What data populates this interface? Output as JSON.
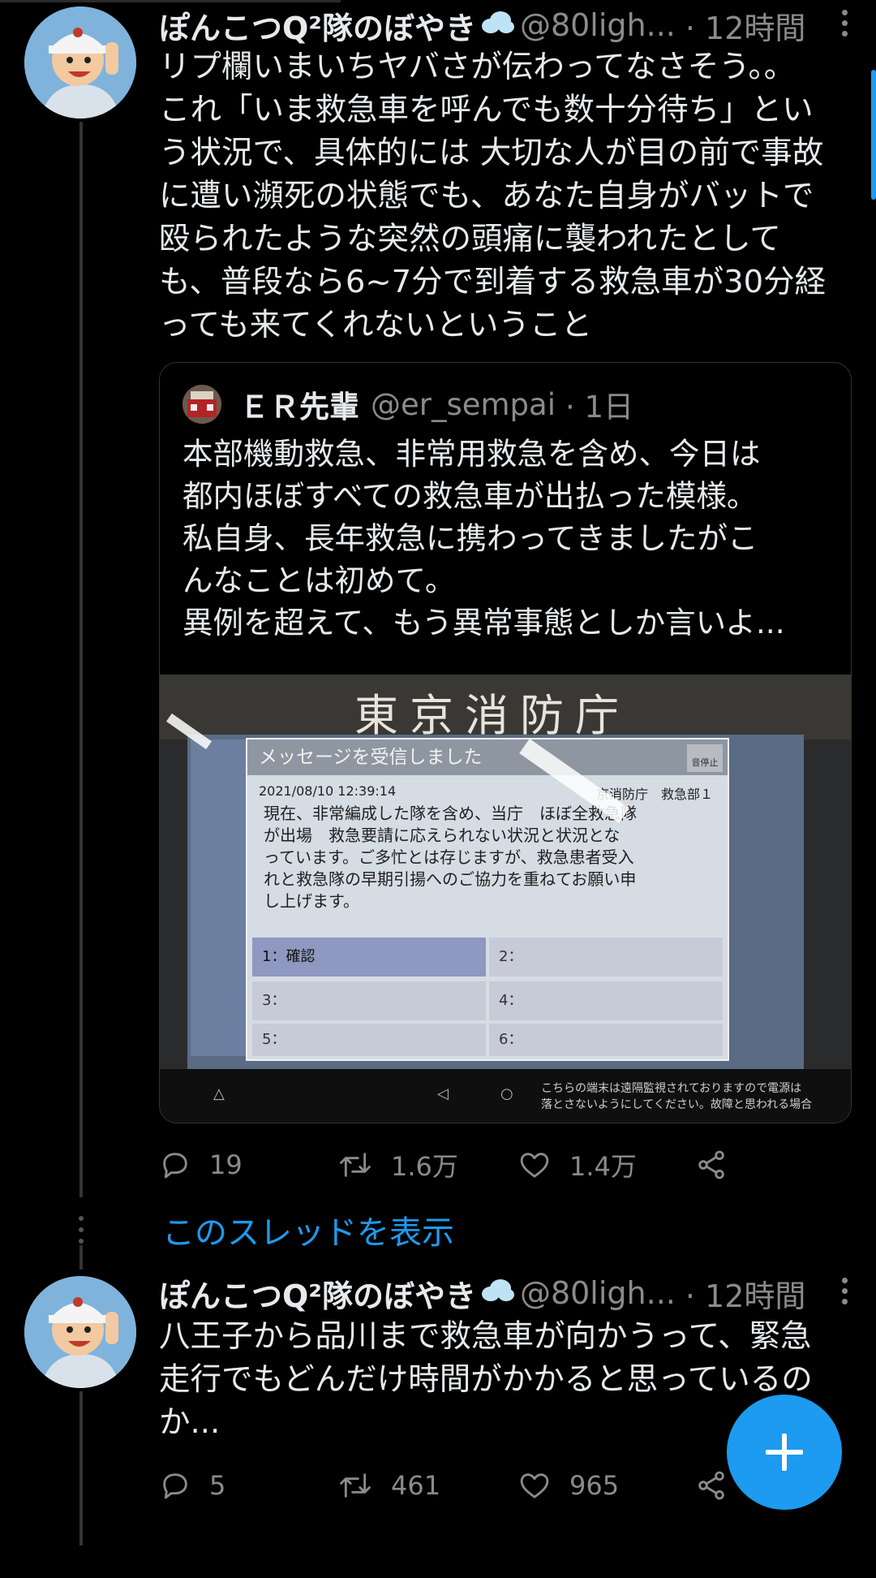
{
  "tweet1": {
    "name": "ぽんこつQ²隊のぼやき",
    "handle": "@80ligh...",
    "time": "· 12時間",
    "text": "リプ欄いまいちヤバさが伝わってなさそう。。\nこれ「いま救急車を呼んでも数十分待ち」とい\nう状況で、具体的には 大切な人が目の前で事故\nに遭い瀕死の状態でも、あなた自身がバットで\n殴られたような突然の頭痛に襲われたとして\nも、普段なら6~7分で到着する救急車が30分経\nっても来てくれないということ",
    "quote": {
      "name": "ＥＲ先輩",
      "handle": "@er_sempai",
      "time": "· 1日",
      "text": "本部機動救急、非常用救急を含め、今日は\n都内ほぼすべての救急車が出払った模様。\n私自身、長年救急に携わってきましたがこ\nんなことは初めて。\n異例を超えて、もう異常事態としか言いよ...",
      "photo": {
        "sign": "東京消防庁",
        "dialog_title": "メッセージを受信しました",
        "stop_label": "音停止",
        "datetime": "2021/08/10 12:39:14",
        "sender": "京消防庁　救急部１",
        "message": "現在、非常編成した隊を含め、当庁　ほぼ全救急隊\nが出場　救急要請に応えられない状況と状況とな\nっています。ご多忙とは存じますが、救急患者受入\nれと救急隊の早期引揚へのご協力を重ねてお願い申\nし上げます。",
        "options": [
          "1：確認",
          "2：",
          "3：",
          "4：",
          "5：",
          "6："
        ],
        "notice": "こちらの端末は遠隔監視されておりますので電源は\n落とさないようにしてください。故障と思われる場合"
      }
    },
    "replies": "19",
    "retweets": "1.6万",
    "likes": "1.4万"
  },
  "show_thread": "このスレッドを表示",
  "tweet2": {
    "name": "ぽんこつQ²隊のぼやき",
    "handle": "@80ligh...",
    "time": "· 12時間",
    "text": "八王子から品川まで救急車が向かうって、緊急\n走行でもどんだけ時間がかかると思っているの\nか...",
    "replies": "5",
    "retweets": "461",
    "likes": "965"
  },
  "colors": {
    "accent": "#1d9bf0",
    "background": "#000000",
    "muted": "#8b8b8b"
  },
  "icons": [
    "reply-icon",
    "retweet-icon",
    "like-icon",
    "share-icon",
    "more-icon",
    "compose-icon"
  ]
}
